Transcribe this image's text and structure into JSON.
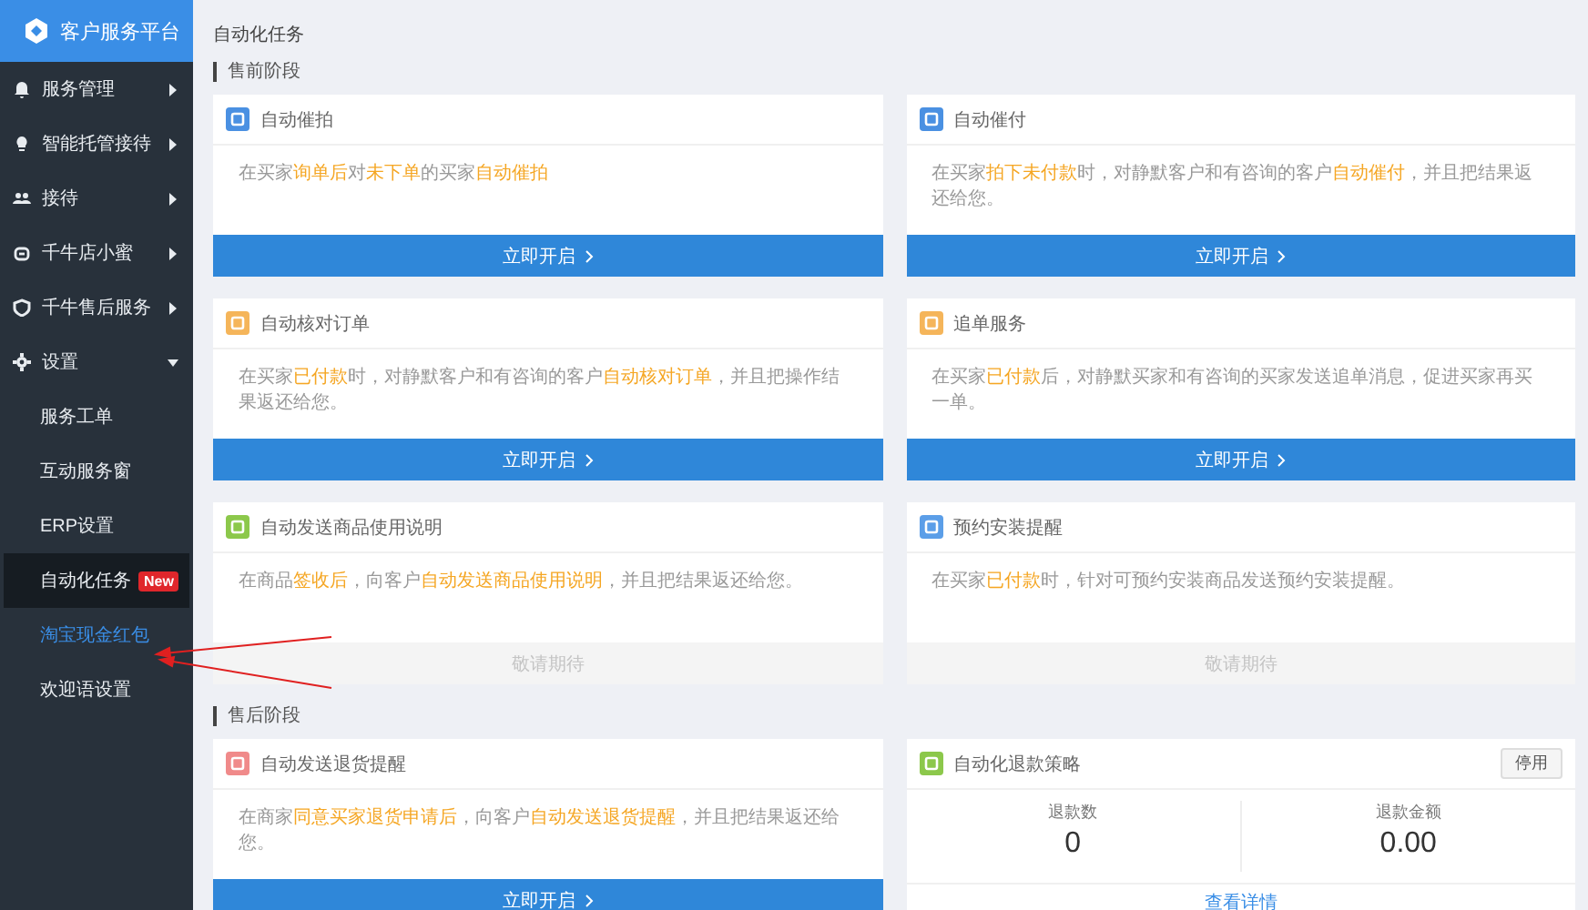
{
  "brand": {
    "title": "客户服务平台"
  },
  "sidebar": {
    "items": [
      {
        "label": "服务管理",
        "expanded": false
      },
      {
        "label": "智能托管接待",
        "expanded": false
      },
      {
        "label": "接待",
        "expanded": false
      },
      {
        "label": "千牛店小蜜",
        "expanded": false
      },
      {
        "label": "千牛售后服务",
        "expanded": false
      },
      {
        "label": "设置",
        "expanded": true,
        "children": [
          {
            "label": "服务工单",
            "selected": false,
            "hovered": false
          },
          {
            "label": "互动服务窗",
            "selected": false,
            "hovered": false
          },
          {
            "label": "ERP设置",
            "selected": false,
            "hovered": false
          },
          {
            "label": "自动化任务",
            "selected": true,
            "hovered": false,
            "badge": "New"
          },
          {
            "label": "淘宝现金红包",
            "selected": false,
            "hovered": true
          },
          {
            "label": "欢迎语设置",
            "selected": false,
            "hovered": false
          }
        ]
      }
    ]
  },
  "page_title": "自动化任务",
  "sections": [
    {
      "title": "售前阶段",
      "cards": [
        {
          "kind": "action",
          "title": "自动催拍",
          "color": "#4a90e2",
          "description": [
            {
              "text": "在买家",
              "highlight": false
            },
            {
              "text": "询单后",
              "highlight": true
            },
            {
              "text": "对",
              "highlight": false
            },
            {
              "text": "未下单",
              "highlight": true
            },
            {
              "text": "的买家",
              "highlight": false
            },
            {
              "text": "自动催拍",
              "highlight": true
            }
          ],
          "button": {
            "label": "立即开启",
            "disabled": false
          }
        },
        {
          "kind": "action",
          "title": "自动催付",
          "color": "#4a90e2",
          "description": [
            {
              "text": "在买家",
              "highlight": false
            },
            {
              "text": "拍下未付款",
              "highlight": true
            },
            {
              "text": "时，对静默客户和有咨询的客户",
              "highlight": false
            },
            {
              "text": "自动催付",
              "highlight": true
            },
            {
              "text": "，并且把结果返还给您。",
              "highlight": false
            }
          ],
          "button": {
            "label": "立即开启",
            "disabled": false
          }
        },
        {
          "kind": "action",
          "title": "自动核对订单",
          "color": "#f5b55a",
          "description": [
            {
              "text": "在买家",
              "highlight": false
            },
            {
              "text": "已付款",
              "highlight": true
            },
            {
              "text": "时，对静默客户和有咨询的客户",
              "highlight": false
            },
            {
              "text": "自动核对订单",
              "highlight": true
            },
            {
              "text": "，并且把操作结果返还给您。",
              "highlight": false
            }
          ],
          "button": {
            "label": "立即开启",
            "disabled": false
          }
        },
        {
          "kind": "action",
          "title": "追单服务",
          "color": "#f5b55a",
          "description": [
            {
              "text": "在买家",
              "highlight": false
            },
            {
              "text": "已付款",
              "highlight": true
            },
            {
              "text": "后，对静默买家和有咨询的买家发送追单消息，促进买家再买一单。",
              "highlight": false
            }
          ],
          "button": {
            "label": "立即开启",
            "disabled": false
          }
        },
        {
          "kind": "action",
          "title": "自动发送商品使用说明",
          "color": "#8cc84b",
          "description": [
            {
              "text": "在商品",
              "highlight": false
            },
            {
              "text": "签收后",
              "highlight": true
            },
            {
              "text": "，向客户",
              "highlight": false
            },
            {
              "text": "自动发送商品使用说明",
              "highlight": true
            },
            {
              "text": "，并且把结果返还给您。",
              "highlight": false
            }
          ],
          "button": {
            "label": "敬请期待",
            "disabled": true
          }
        },
        {
          "kind": "action",
          "title": "预约安装提醒",
          "color": "#5b9ee8",
          "description": [
            {
              "text": "在买家",
              "highlight": false
            },
            {
              "text": "已付款",
              "highlight": true
            },
            {
              "text": "时，针对可预约安装商品发送预约安装提醒。",
              "highlight": false
            }
          ],
          "button": {
            "label": "敬请期待",
            "disabled": true
          }
        }
      ]
    },
    {
      "title": "售后阶段",
      "cards": [
        {
          "kind": "action",
          "title": "自动发送退货提醒",
          "color": "#f08a8a",
          "description": [
            {
              "text": "在商家",
              "highlight": false
            },
            {
              "text": "同意买家退货申请后",
              "highlight": true
            },
            {
              "text": "，向客户",
              "highlight": false
            },
            {
              "text": "自动发送退货提醒",
              "highlight": true
            },
            {
              "text": "，并且把结果返还给您。",
              "highlight": false
            }
          ],
          "button": {
            "label": "立即开启",
            "disabled": false
          }
        },
        {
          "kind": "stats",
          "title": "自动化退款策略",
          "color": "#8cc84b",
          "header_button": "停用",
          "stats": [
            {
              "label": "退款数",
              "value": "0"
            },
            {
              "label": "退款金额",
              "value": "0.00"
            }
          ],
          "link": "查看详情"
        }
      ]
    }
  ]
}
